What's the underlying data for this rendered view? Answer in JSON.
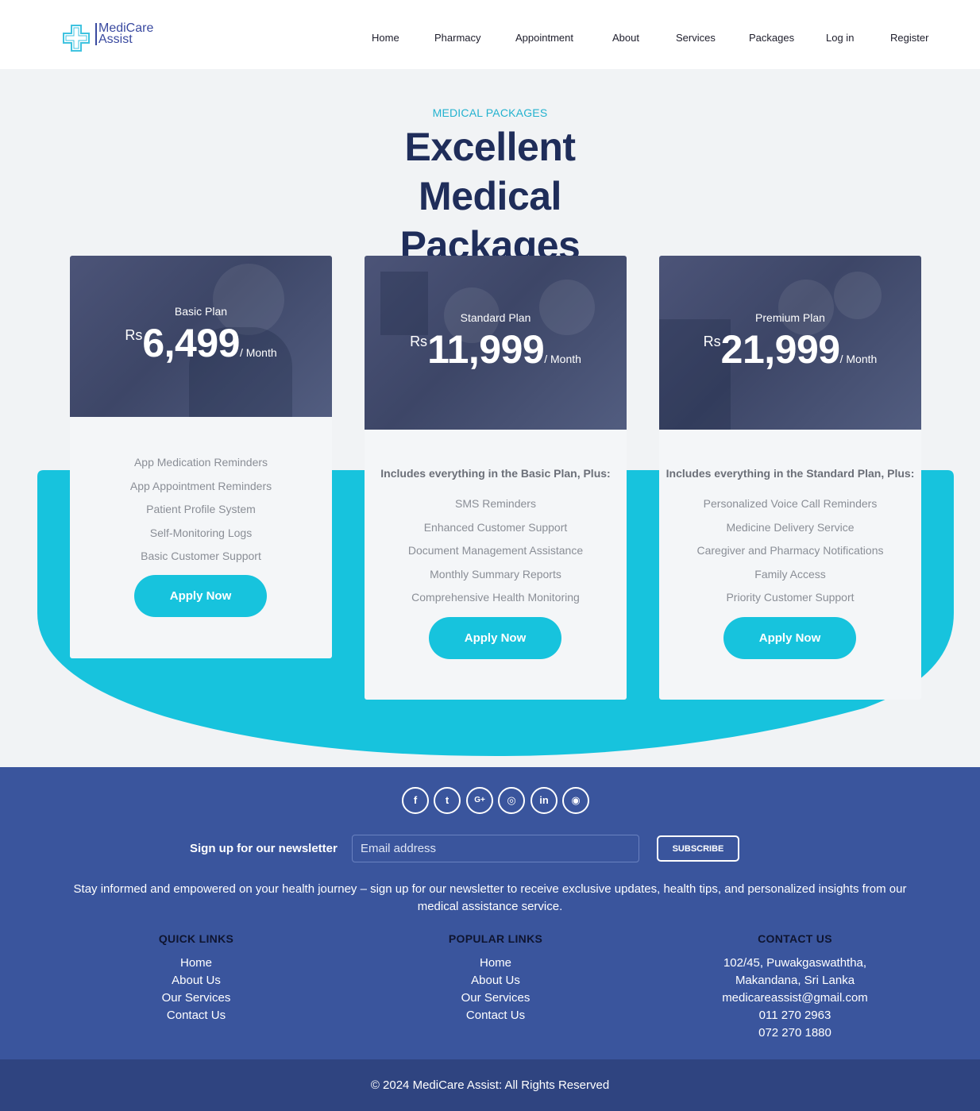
{
  "brand": {
    "name_line1": "MediCare",
    "name_line2": "Assist",
    "logo_color": "#3a4aa0",
    "accent": "#17c3dd"
  },
  "nav": {
    "items": [
      "Home",
      "Pharmacy",
      "Appointment",
      "About",
      "Services",
      "Packages",
      "Log in",
      "Register"
    ]
  },
  "hero": {
    "eyebrow": "MEDICAL PACKAGES",
    "title_line1": "Excellent Medical",
    "title_line2": "Packages"
  },
  "plans": [
    {
      "name": "Basic Plan",
      "currency": "Rs",
      "amount": "6,499",
      "period": "/ Month",
      "includes": "",
      "features": [
        "App Medication Reminders",
        "App Appointment Reminders",
        "Patient Profile System",
        "Self-Monitoring Logs",
        "Basic Customer Support"
      ],
      "button": "Apply Now"
    },
    {
      "name": "Standard Plan",
      "currency": "Rs",
      "amount": "11,999",
      "period": "/ Month",
      "includes": "Includes everything in the Basic Plan, Plus:",
      "features": [
        "SMS Reminders",
        "Enhanced Customer Support",
        "Document Management Assistance",
        "Monthly Summary Reports",
        "Comprehensive Health Monitoring"
      ],
      "button": "Apply Now"
    },
    {
      "name": "Premium Plan",
      "currency": "Rs",
      "amount": "21,999",
      "period": "/ Month",
      "includes": "Includes everything in the Standard Plan, Plus:",
      "features": [
        "Personalized Voice Call Reminders",
        "Medicine Delivery Service",
        "Caregiver and Pharmacy Notifications",
        "Family Access",
        "Priority Customer Support"
      ],
      "button": "Apply Now"
    }
  ],
  "footer": {
    "social_icons": [
      "facebook-icon",
      "twitter-icon",
      "google-plus-icon",
      "instagram-icon",
      "linkedin-icon",
      "github-icon"
    ],
    "social_glyphs": [
      "f",
      "t",
      "G+",
      "◎",
      "in",
      "◉"
    ],
    "newsletter_label": "Sign up for our newsletter",
    "email_placeholder": "Email address",
    "subscribe": "SUBSCRIBE",
    "newsletter_text": "Stay informed and empowered on your health journey – sign up for our newsletter to receive exclusive updates, health tips, and personalized insights from our medical assistance service.",
    "quick_links": {
      "heading": "QUICK LINKS",
      "items": [
        "Home",
        "About Us",
        "Our Services",
        "Contact Us"
      ]
    },
    "popular_links": {
      "heading": "POPULAR LINKS",
      "items": [
        "Home",
        "About Us",
        "Our Services",
        "Contact Us"
      ]
    },
    "contact": {
      "heading": "CONTACT US",
      "lines": [
        "102/45, Puwakgaswaththa,",
        "Makandana, Sri Lanka",
        "medicareassist@gmail.com",
        "011 270 2963",
        "072 270 1880"
      ]
    },
    "copyright": "© 2024 MediCare Assist: All Rights Reserved",
    "bg_color": "#3a559d"
  }
}
